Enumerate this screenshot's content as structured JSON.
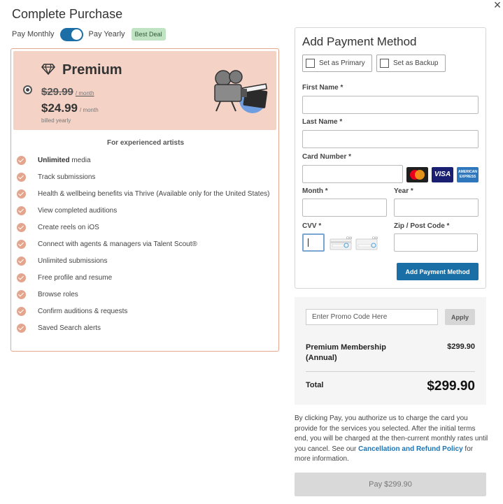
{
  "modal": {
    "title": "Complete Purchase",
    "close_glyph": "×"
  },
  "billing": {
    "monthly_label": "Pay Monthly",
    "yearly_label": "Pay Yearly",
    "badge": "Best Deal",
    "yearly_selected": true
  },
  "plan": {
    "name": "Premium",
    "old_price": "$29.99",
    "old_price_period": "/ month",
    "new_price": "$24.99",
    "new_price_period": "/ month",
    "billed_note": "billed yearly",
    "tagline": "For experienced artists",
    "features": [
      {
        "bold": "Unlimited",
        "text": " media"
      },
      {
        "bold": "",
        "text": "Track submissions"
      },
      {
        "bold": "",
        "text": "Health & wellbeing benefits via Thrive (Available only for the United States)"
      },
      {
        "bold": "",
        "text": "View completed auditions"
      },
      {
        "bold": "",
        "text": "Create reels on iOS"
      },
      {
        "bold": "",
        "text": "Connect with agents & managers via Talent Scout®"
      },
      {
        "bold": "",
        "text": "Unlimited submissions"
      },
      {
        "bold": "",
        "text": "Free profile and resume"
      },
      {
        "bold": "",
        "text": "Browse roles"
      },
      {
        "bold": "",
        "text": "Confirm auditions & requests"
      },
      {
        "bold": "",
        "text": "Saved Search alerts"
      }
    ]
  },
  "payment": {
    "title": "Add Payment Method",
    "primary_label": "Set as Primary",
    "backup_label": "Set as Backup",
    "first_name_label": "First Name *",
    "last_name_label": "Last Name *",
    "card_number_label": "Card Number *",
    "month_label": "Month *",
    "year_label": "Year *",
    "cvv_label": "CVV *",
    "zip_label": "Zip / Post Code *",
    "add_button": "Add Payment Method",
    "card_brands": {
      "visa": "VISA",
      "amex_line1": "AMERICAN",
      "amex_line2": "EXPRESS"
    },
    "cvv_hint": "CVV"
  },
  "summary": {
    "promo_placeholder": "Enter Promo Code Here",
    "apply_label": "Apply",
    "item_name": "Premium Membership (Annual)",
    "item_price": "$299.90",
    "total_label": "Total",
    "total_value": "$299.90"
  },
  "legal": {
    "text_before": "By clicking Pay, you authorize us to charge the card you provide for the services you selected. After the initial terms end, you will be charged at the then-current monthly rates until you cancel. See our ",
    "link_text": "Cancellation and Refund Policy",
    "text_after": " for more information."
  },
  "pay_button": "Pay $299.90",
  "colors": {
    "accent": "#1a6fa6",
    "plan_bg": "#f4d3c6",
    "check": "#e3a58d",
    "badge_bg": "#bfe3c3"
  }
}
